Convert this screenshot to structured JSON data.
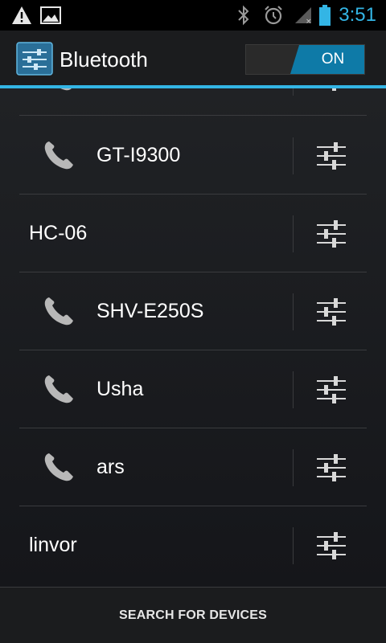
{
  "status_bar": {
    "time": "3:51",
    "icons": [
      "warning-icon",
      "image-icon",
      "bluetooth-icon",
      "alarm-icon",
      "signal-off-icon",
      "battery-icon"
    ],
    "accent_color": "#33b5e5"
  },
  "action_bar": {
    "title": "Bluetooth",
    "toggle_label": "ON"
  },
  "devices": [
    {
      "name": "",
      "icon": "phone-icon",
      "partial": true
    },
    {
      "name": "GT-I9300",
      "icon": "phone-icon"
    },
    {
      "name": "HC-06",
      "icon": null
    },
    {
      "name": "SHV-E250S",
      "icon": "phone-icon"
    },
    {
      "name": "Usha",
      "icon": "phone-icon"
    },
    {
      "name": "ars",
      "icon": "phone-icon"
    },
    {
      "name": "linvor",
      "icon": null
    }
  ],
  "bottom_bar": {
    "search_label": "SEARCH FOR DEVICES"
  }
}
